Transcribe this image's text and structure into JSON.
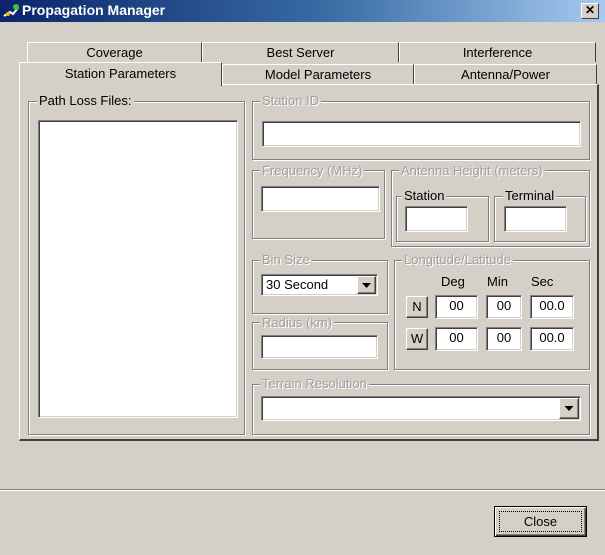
{
  "window": {
    "title": "Propagation Manager",
    "close_symbol": "✕"
  },
  "tabs": {
    "back_row": [
      "Coverage",
      "Best Server",
      "Interference"
    ],
    "front_row": [
      "Station Parameters",
      "Model Parameters",
      "Antenna/Power"
    ],
    "active": "Station Parameters"
  },
  "path_loss": {
    "label": "Path Loss Files:",
    "files": []
  },
  "station_id": {
    "label": "Station ID",
    "value": ""
  },
  "frequency": {
    "label": "Frequency (MHz)",
    "value": ""
  },
  "antenna_height": {
    "label": "Antenna Height (meters)",
    "station_label": "Station",
    "station_value": "",
    "terminal_label": "Terminal",
    "terminal_value": ""
  },
  "bin_size": {
    "label": "Bin Size",
    "selected": "30 Second"
  },
  "radius": {
    "label": "Radius (km)",
    "value": ""
  },
  "lonlat": {
    "label": "Longitude/Latitude",
    "headers": [
      "Deg",
      "Min",
      "Sec"
    ],
    "lat": {
      "hemisphere": "N",
      "deg": "00",
      "min": "00",
      "sec": "00.0"
    },
    "lon": {
      "hemisphere": "W",
      "deg": "00",
      "min": "00",
      "sec": "00.0"
    }
  },
  "terrain": {
    "label": "Terrain Resolution",
    "selected": ""
  },
  "buttons": {
    "close": "Close"
  },
  "icons": {
    "app": "antenna-icon",
    "dropdown": "chevron-down-icon"
  }
}
